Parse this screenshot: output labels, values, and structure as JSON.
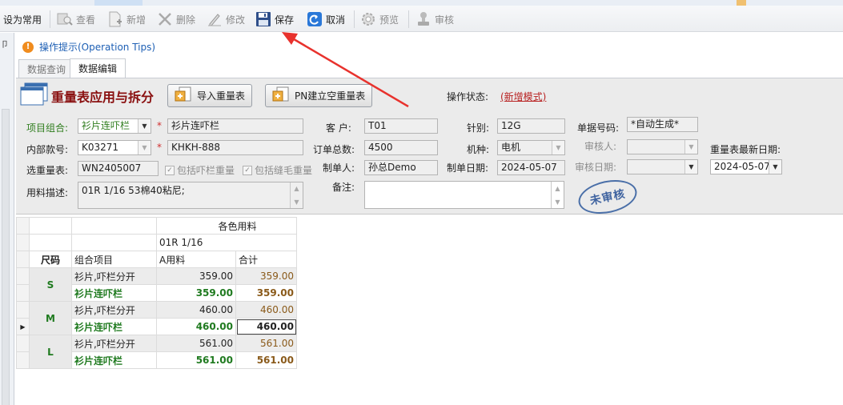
{
  "toolbar": {
    "set_common": "设为常用",
    "view": "查看",
    "new": "新增",
    "delete": "删除",
    "edit": "修改",
    "save": "保存",
    "cancel": "取消",
    "preview": "预览",
    "review": "审核"
  },
  "tips": "操作提示(Operation Tips)",
  "tabs": {
    "query": "数据查询",
    "edit": "数据编辑"
  },
  "form": {
    "title": "重量表应用与拆分",
    "import_btn": "导入重量表",
    "pn_btn": "PN建立空重量表",
    "status_label": "操作状态:",
    "status_value": "(新增模式)",
    "combo_label": "项目组合:",
    "combo_value": "衫片连吓栏",
    "combo_text": "衫片连吓栏",
    "internal_label": "内部款号:",
    "internal_value": "K03271",
    "internal_text": "KHKH-888",
    "select_label": "选重量表:",
    "select_value": "WN2405007",
    "chk_bar_label": "包括吓栏重量",
    "chk_bar_mark": "✓",
    "chk_seam_label": "包括缝毛重量",
    "chk_seam_mark": "✓",
    "material_label": "用料描述:",
    "material_value": "01R 1/16 53棉40粘尼;",
    "customer_label": "客 户:",
    "customer_value": "T01",
    "order_total_label": "订单总数:",
    "order_total_value": "4500",
    "maker_label": "制单人:",
    "maker_value": "孙总Demo",
    "remark_label": "备注:",
    "remark_value": "",
    "needle_label": "针别:",
    "needle_value": "12G",
    "machine_label": "机种:",
    "machine_value": "电机",
    "make_date_label": "制单日期:",
    "make_date_value": "2024-05-07",
    "doc_no_label": "单据号码:",
    "doc_no_value": "*自动生成*",
    "reviewer_label": "审核人:",
    "reviewer_value": "",
    "review_date_label": "审核日期:",
    "review_date_value": "",
    "latest_date_label": "重量表最新日期:",
    "latest_date_value": "2024-05-07",
    "stamp": "未审核"
  },
  "grid": {
    "group_header": "各色用料",
    "material_header": "01R 1/16",
    "col_size": "尺码",
    "col_item": "组合项目",
    "col_a": "A用料",
    "col_total": "合计",
    "rows": [
      {
        "size": "S",
        "split_item": "衫片,吓栏分开",
        "split_a": "359.00",
        "split_total": "359.00",
        "comb_item": "衫片连吓栏",
        "comb_a": "359.00",
        "comb_total": "359.00"
      },
      {
        "size": "M",
        "split_item": "衫片,吓栏分开",
        "split_a": "460.00",
        "split_total": "460.00",
        "comb_item": "衫片连吓栏",
        "comb_a": "460.00",
        "comb_total": "460.00"
      },
      {
        "size": "L",
        "split_item": "衫片,吓栏分开",
        "split_a": "561.00",
        "split_total": "561.00",
        "comb_item": "衫片连吓栏",
        "comb_a": "561.00",
        "comb_total": "561.00"
      }
    ]
  },
  "colors": {
    "title": "#8a1010",
    "status": "#b82020",
    "green_text": "#1f7a1f",
    "total_text": "#8a5a1a",
    "arrow": "#e8322d"
  }
}
